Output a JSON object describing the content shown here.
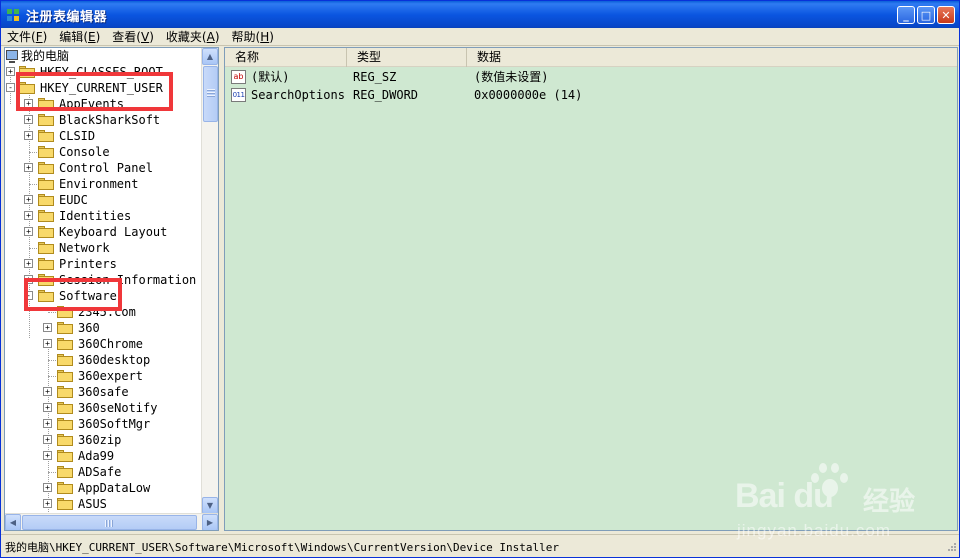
{
  "window": {
    "title": "注册表编辑器",
    "buttons": {
      "minimize": "_",
      "maximize": "□",
      "close": "✕"
    }
  },
  "menubar": [
    {
      "label": "文件",
      "accel": "F"
    },
    {
      "label": "编辑",
      "accel": "E"
    },
    {
      "label": "查看",
      "accel": "V"
    },
    {
      "label": "收藏夹",
      "accel": "A"
    },
    {
      "label": "帮助",
      "accel": "H"
    }
  ],
  "tree": {
    "root": "我的电脑",
    "hives": [
      "HKEY_CLASSES_ROOT",
      "HKEY_CURRENT_USER"
    ],
    "hkcu_children": [
      {
        "label": "AppEvents",
        "expandable": true
      },
      {
        "label": "BlackSharkSoft",
        "expandable": true
      },
      {
        "label": "CLSID",
        "expandable": true
      },
      {
        "label": "Console",
        "expandable": false
      },
      {
        "label": "Control Panel",
        "expandable": true
      },
      {
        "label": "Environment",
        "expandable": false
      },
      {
        "label": "EUDC",
        "expandable": true
      },
      {
        "label": "Identities",
        "expandable": true
      },
      {
        "label": "Keyboard Layout",
        "expandable": true
      },
      {
        "label": "Network",
        "expandable": false
      },
      {
        "label": "Printers",
        "expandable": true
      },
      {
        "label": "Session Information",
        "expandable": true
      },
      {
        "label": "Software",
        "expandable": true,
        "expanded": true
      }
    ],
    "software_children": [
      {
        "label": "2345.com",
        "expandable": false
      },
      {
        "label": "360",
        "expandable": true
      },
      {
        "label": "360Chrome",
        "expandable": true
      },
      {
        "label": "360desktop",
        "expandable": false
      },
      {
        "label": "360expert",
        "expandable": false
      },
      {
        "label": "360safe",
        "expandable": true
      },
      {
        "label": "360seNotify",
        "expandable": true
      },
      {
        "label": "360SoftMgr",
        "expandable": true
      },
      {
        "label": "360zip",
        "expandable": true
      },
      {
        "label": "Ada99",
        "expandable": true
      },
      {
        "label": "ADSafe",
        "expandable": false
      },
      {
        "label": "AppDataLow",
        "expandable": true
      },
      {
        "label": "ASUS",
        "expandable": true
      }
    ]
  },
  "list": {
    "columns": [
      "名称",
      "类型",
      "数据"
    ],
    "rows": [
      {
        "icon": "string-value-icon",
        "icon_text": "ab",
        "name": "(默认)",
        "type": "REG_SZ",
        "data": "(数值未设置)"
      },
      {
        "icon": "dword-value-icon",
        "icon_text": "011",
        "name": "SearchOptions",
        "type": "REG_DWORD",
        "data": "0x0000000e (14)"
      }
    ]
  },
  "statusbar": {
    "path": "我的电脑\\HKEY_CURRENT_USER\\Software\\Microsoft\\Windows\\CurrentVersion\\Device Installer"
  },
  "watermark": {
    "brand": "Bai du",
    "service": "经验",
    "url": "jingyan.baidu.com"
  },
  "colors": {
    "titlebar": "#0a55e0",
    "right_pane_bg": "#cfe8d1",
    "annotation": "#f0373a",
    "folder": "#f8d96a"
  }
}
